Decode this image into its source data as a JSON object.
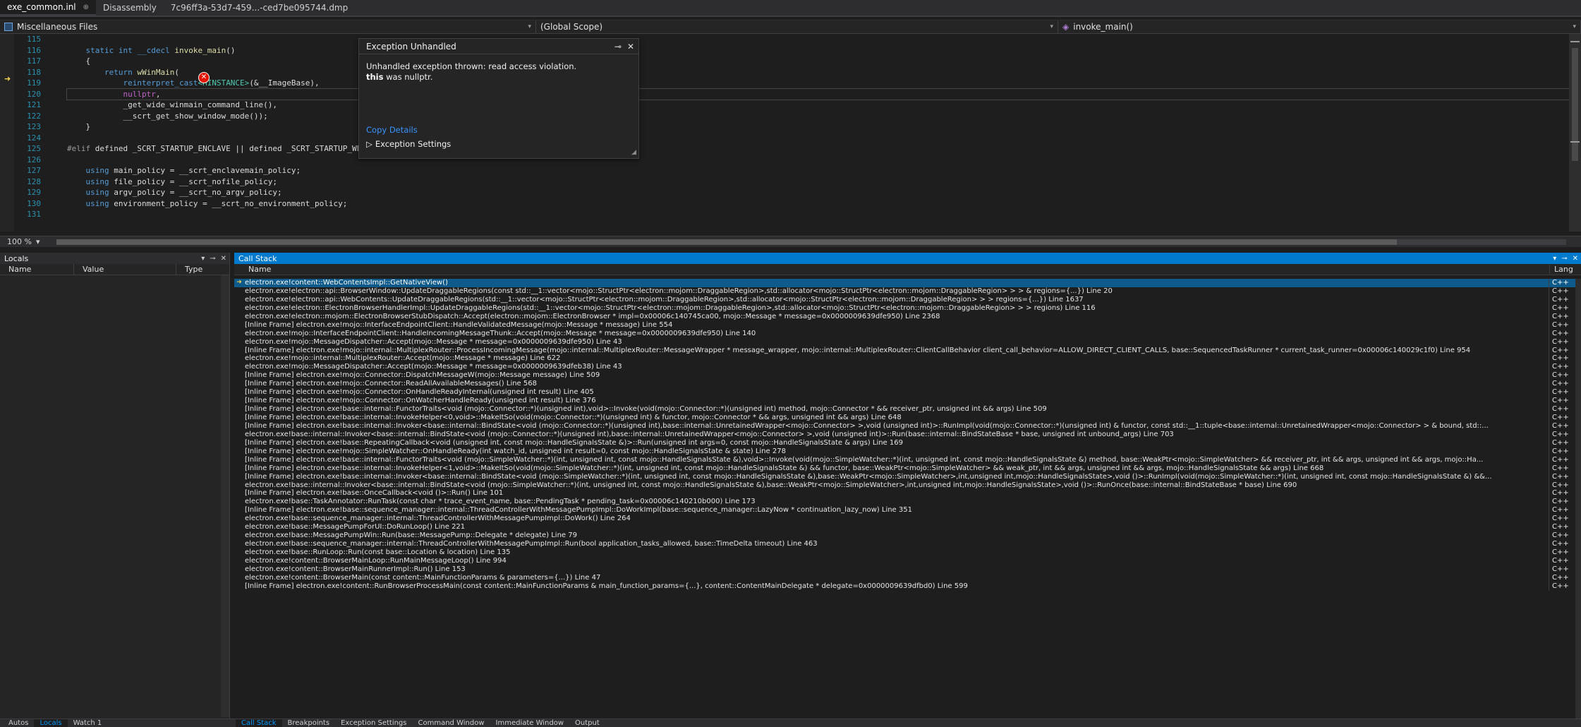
{
  "doc_tabs": [
    {
      "label": "exe_common.inl",
      "glyph": "⊕",
      "active": true
    },
    {
      "label": "Disassembly",
      "active": false
    },
    {
      "label": "7c96ff3a-53d7-459...-ced7be095744.dmp",
      "active": false
    }
  ],
  "navbar": {
    "project": "Miscellaneous Files",
    "scope": "(Global Scope)",
    "member": "invoke_main()"
  },
  "editor": {
    "line_numbers": [
      "115",
      "116",
      "117",
      "118",
      "119",
      "120",
      "121",
      "122",
      "123",
      "124",
      "125",
      "126",
      "127",
      "128",
      "129",
      "130",
      "131"
    ],
    "code": {
      "l115": "",
      "l116_kw1": "static",
      "l116_kw2": "int",
      "l116_kw3": "__cdecl",
      "l116_fn": "invoke_main",
      "l116_rest": "()",
      "l117": "{",
      "l118_kw": "return",
      "l118_fn": "wWinMain",
      "l118_rest": "(",
      "l119_kw": "reinterpret_cast",
      "l119_ty": "<HINSTANCE>",
      "l119_rest": "(&__ImageBase),",
      "l120_mac": "nullptr",
      "l120_rest": ",",
      "l121": "_get_wide_winmain_command_line(),",
      "l122": "__scrt_get_show_window_mode());",
      "l123": "}",
      "l124": "",
      "l125_pp": "#elif",
      "l125_rest": " defined _SCRT_STARTUP_ENCLAVE || defined _SCRT_STARTUP_WENCLAVE",
      "l126": "",
      "l127_kw": "using",
      "l127_rest": " main_policy = __scrt_enclavemain_policy;",
      "l128_kw": "using",
      "l128_rest": " file_policy = __scrt_nofile_policy;",
      "l129_kw": "using",
      "l129_rest": " argv_policy = __scrt_no_argv_policy;",
      "l130_kw": "using",
      "l130_rest": " environment_policy = __scrt_no_environment_policy;",
      "l131": ""
    }
  },
  "exception": {
    "title": "Exception Unhandled",
    "pin": "⊸",
    "close": "✕",
    "message_line1": "Unhandled exception thrown: read access violation.",
    "message_bold": "this",
    "message_line2": " was nullptr.",
    "copy_details": "Copy Details",
    "settings_label": "Exception Settings",
    "badge": "✕"
  },
  "editor_status": {
    "zoom": "100 %"
  },
  "locals": {
    "title": "Locals",
    "columns": [
      "Name",
      "Value",
      "Type"
    ]
  },
  "callstack": {
    "title": "Call Stack",
    "columns": [
      "Name",
      "Lang"
    ],
    "rows": [
      "electron.exe!content::WebContentsImpl::GetNativeView()",
      "electron.exe!electron::api::BrowserWindow::UpdateDraggableRegions(const std::__1::vector<mojo::StructPtr<electron::mojom::DraggableRegion>,std::allocator<mojo::StructPtr<electron::mojom::DraggableRegion> > > & regions={...}) Line 20",
      "electron.exe!electron::api::WebContents::UpdateDraggableRegions(std::__1::vector<mojo::StructPtr<electron::mojom::DraggableRegion>,std::allocator<mojo::StructPtr<electron::mojom::DraggableRegion> > > regions={...}) Line 1637",
      "electron.exe!electron::ElectronBrowserHandlerImpl::UpdateDraggableRegions(std::__1::vector<mojo::StructPtr<electron::mojom::DraggableRegion>,std::allocator<mojo::StructPtr<electron::mojom::DraggableRegion> > > regions) Line 116",
      "electron.exe!electron::mojom::ElectronBrowserStubDispatch::Accept(electron::mojom::ElectronBrowser * impl=0x00006c140745ca00, mojo::Message * message=0x0000009639dfe950) Line 2368",
      "[Inline Frame] electron.exe!mojo::InterfaceEndpointClient::HandleValidatedMessage(mojo::Message * message) Line 554",
      "electron.exe!mojo::InterfaceEndpointClient::HandleIncomingMessageThunk::Accept(mojo::Message * message=0x0000009639dfe950) Line 140",
      "electron.exe!mojo::MessageDispatcher::Accept(mojo::Message * message=0x0000009639dfe950) Line 43",
      "[Inline Frame] electron.exe!mojo::internal::MultiplexRouter::ProcessIncomingMessage(mojo::internal::MultiplexRouter::MessageWrapper * message_wrapper, mojo::internal::MultiplexRouter::ClientCallBehavior client_call_behavior=ALLOW_DIRECT_CLIENT_CALLS, base::SequencedTaskRunner * current_task_runner=0x00006c140029c1f0) Line 954",
      "electron.exe!mojo::internal::MultiplexRouter::Accept(mojo::Message * message) Line 622",
      "electron.exe!mojo::MessageDispatcher::Accept(mojo::Message * message=0x0000009639dfeb38) Line 43",
      "[Inline Frame] electron.exe!mojo::Connector::DispatchMessageW(mojo::Message message) Line 509",
      "[Inline Frame] electron.exe!mojo::Connector::ReadAllAvailableMessages() Line 568",
      "[Inline Frame] electron.exe!mojo::Connector::OnHandleReadyInternal(unsigned int result) Line 405",
      "[Inline Frame] electron.exe!mojo::Connector::OnWatcherHandleReady(unsigned int result) Line 376",
      "[Inline Frame] electron.exe!base::internal::FunctorTraits<void (mojo::Connector::*)(unsigned int),void>::Invoke(void(mojo::Connector::*)(unsigned int) method, mojo::Connector * && receiver_ptr, unsigned int && args) Line 509",
      "[Inline Frame] electron.exe!base::internal::InvokeHelper<0,void>::MakeItSo(void(mojo::Connector::*)(unsigned int) & functor, mojo::Connector * && args, unsigned int && args) Line 648",
      "[Inline Frame] electron.exe!base::internal::Invoker<base::internal::BindState<void (mojo::Connector::*)(unsigned int),base::internal::UnretainedWrapper<mojo::Connector> >,void (unsigned int)>::RunImpl(void(mojo::Connector::*)(unsigned int) & functor, const std::__1::tuple<base::internal::UnretainedWrapper<mojo::Connector> > & bound, std::...",
      "electron.exe!base::internal::Invoker<base::internal::BindState<void (mojo::Connector::*)(unsigned int),base::internal::UnretainedWrapper<mojo::Connector> >,void (unsigned int)>::Run(base::internal::BindStateBase * base, unsigned int unbound_args) Line 703",
      "[Inline Frame] electron.exe!base::RepeatingCallback<void (unsigned int, const mojo::HandleSignalsState &)>::Run(unsigned int args=0, const mojo::HandleSignalsState & args) Line 169",
      "[Inline Frame] electron.exe!mojo::SimpleWatcher::OnHandleReady(int watch_id, unsigned int result=0, const mojo::HandleSignalsState & state) Line 278",
      "[Inline Frame] electron.exe!base::internal::FunctorTraits<void (mojo::SimpleWatcher::*)(int, unsigned int, const mojo::HandleSignalsState &),void>::Invoke(void(mojo::SimpleWatcher::*)(int, unsigned int, const mojo::HandleSignalsState &) method, base::WeakPtr<mojo::SimpleWatcher> && receiver_ptr, int && args, unsigned int && args, mojo::Ha...",
      "[Inline Frame] electron.exe!base::internal::InvokeHelper<1,void>::MakeItSo(void(mojo::SimpleWatcher::*)(int, unsigned int, const mojo::HandleSignalsState &) && functor, base::WeakPtr<mojo::SimpleWatcher> && weak_ptr, int && args, unsigned int && args, mojo::HandleSignalsState && args) Line 668",
      "[Inline Frame] electron.exe!base::internal::Invoker<base::internal::BindState<void (mojo::SimpleWatcher::*)(int, unsigned int, const mojo::HandleSignalsState &),base::WeakPtr<mojo::SimpleWatcher>,int,unsigned int,mojo::HandleSignalsState>,void ()>::RunImpl(void(mojo::SimpleWatcher::*)(int, unsigned int, const mojo::HandleSignalsState &) &&...",
      "electron.exe!base::internal::Invoker<base::internal::BindState<void (mojo::SimpleWatcher::*)(int, unsigned int, const mojo::HandleSignalsState &),base::WeakPtr<mojo::SimpleWatcher>,int,unsigned int,mojo::HandleSignalsState>,void ()>::RunOnce(base::internal::BindStateBase * base) Line 690",
      "[Inline Frame] electron.exe!base::OnceCallback<void ()>::Run() Line 101",
      "electron.exe!base::TaskAnnotator::RunTask(const char * trace_event_name, base::PendingTask * pending_task=0x00006c140210b000) Line 173",
      "[Inline Frame] electron.exe!base::sequence_manager::internal::ThreadControllerWithMessagePumpImpl::DoWorkImpl(base::sequence_manager::LazyNow * continuation_lazy_now) Line 351",
      "electron.exe!base::sequence_manager::internal::ThreadControllerWithMessagePumpImpl::DoWork() Line 264",
      "electron.exe!base::MessagePumpForUI::DoRunLoop() Line 221",
      "electron.exe!base::MessagePumpWin::Run(base::MessagePump::Delegate * delegate) Line 79",
      "electron.exe!base::sequence_manager::internal::ThreadControllerWithMessagePumpImpl::Run(bool application_tasks_allowed, base::TimeDelta timeout) Line 463",
      "electron.exe!base::RunLoop::Run(const base::Location & location) Line 135",
      "electron.exe!content::BrowserMainLoop::RunMainMessageLoop() Line 994",
      "electron.exe!content::BrowserMainRunnerImpl::Run() Line 153",
      "electron.exe!content::BrowserMain(const content::MainFunctionParams & parameters={...}) Line 47",
      "[Inline Frame] electron.exe!content::RunBrowserProcessMain(const content::MainFunctionParams & main_function_params={...}, content::ContentMainDelegate * delegate=0x0000009639dfbd0) Line 599"
    ],
    "lang": "C++"
  },
  "bottom_tabs_left": [
    "Autos",
    "Locals",
    "Watch 1"
  ],
  "bottom_tabs_right": [
    "Call Stack",
    "Breakpoints",
    "Exception Settings",
    "Command Window",
    "Immediate Window",
    "Output"
  ]
}
